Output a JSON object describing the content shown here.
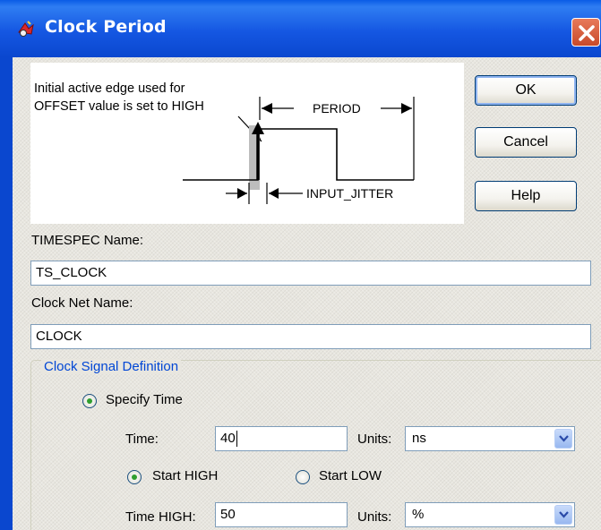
{
  "window": {
    "title": "Clock Period"
  },
  "diagram": {
    "note_line1": "Initial active edge used for",
    "note_line2": "OFFSET value is set to HIGH",
    "period_label": "PERIOD",
    "jitter_label": "INPUT_JITTER"
  },
  "buttons": {
    "ok": "OK",
    "cancel": "Cancel",
    "help": "Help"
  },
  "timespec": {
    "label": "TIMESPEC Name:",
    "value": "TS_CLOCK"
  },
  "clock_net": {
    "label": "Clock Net Name:",
    "value": "CLOCK"
  },
  "signal_group": {
    "legend": "Clock Signal Definition",
    "specify_time_label": "Specify Time",
    "specify_time_selected": true,
    "time_label": "Time:",
    "time_value": "40",
    "units_label": "Units:",
    "time_units": "ns",
    "start_high_label": "Start HIGH",
    "start_high_selected": true,
    "start_low_label": "Start LOW",
    "start_low_selected": false,
    "time_high_label": "Time HIGH:",
    "time_high_value": "50",
    "time_high_units": "%"
  },
  "colors": {
    "title_bar": "#0a5ce6",
    "legend_text": "#0046d5",
    "radio_dot": "#2f9e2f"
  },
  "icons": {
    "title": "clock-wizard-icon",
    "close": "close-icon",
    "dropdown": "chevron-down-icon"
  }
}
